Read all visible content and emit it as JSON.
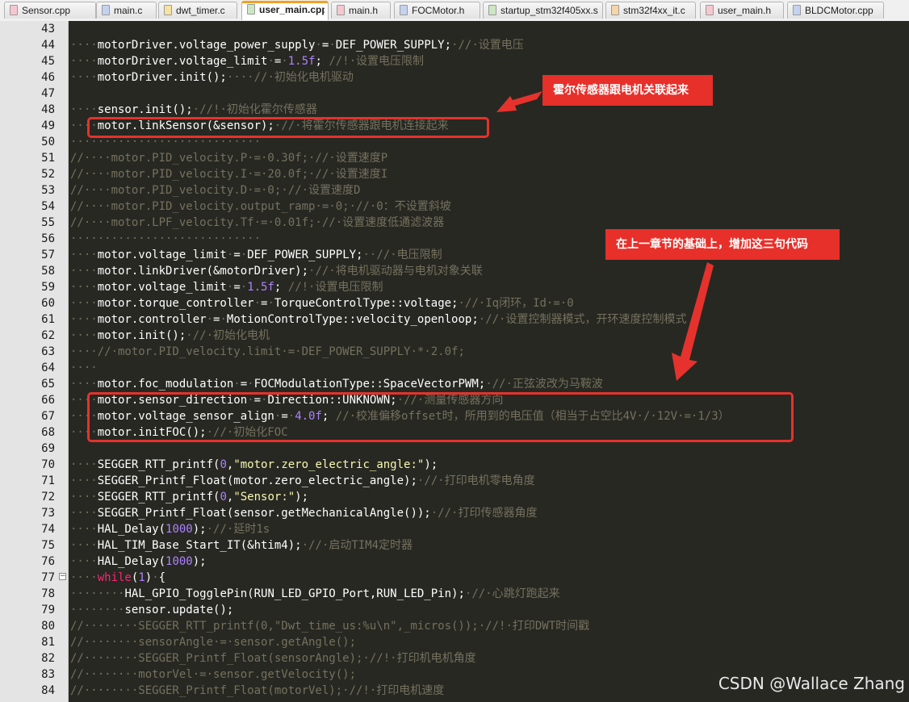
{
  "tabs": [
    {
      "label": "Sensor.cpp",
      "color": "#f7c7cf"
    },
    {
      "label": "main.c",
      "color": "#c5d3f0"
    },
    {
      "label": "dwt_timer.c",
      "color": "#f6e3a0"
    },
    {
      "label": "user_main.cpp",
      "color": "#cde7c2",
      "active": true
    },
    {
      "label": "main.h",
      "color": "#f7c7cf"
    },
    {
      "label": "FOCMotor.h",
      "color": "#c5d3f0"
    },
    {
      "label": "startup_stm32f405xx.s",
      "color": "#cde7c2"
    },
    {
      "label": "stm32f4xx_it.c",
      "color": "#f6d6a8"
    },
    {
      "label": "user_main.h",
      "color": "#f7c7cf"
    },
    {
      "label": "BLDCMotor.cpp",
      "color": "#c5d3f0"
    }
  ],
  "lines": [
    {
      "n": "43",
      "s": []
    },
    {
      "n": "44",
      "s": [
        [
          "ws",
          "····"
        ],
        [
          "",
          "motorDriver.voltage_power_supply"
        ],
        [
          "ws",
          "·"
        ],
        [
          "",
          "="
        ],
        [
          "ws",
          "·"
        ],
        [
          "",
          "DEF_POWER_SUPPLY;"
        ],
        [
          "ws",
          "·"
        ],
        [
          "cm",
          "//·设置电压"
        ]
      ]
    },
    {
      "n": "45",
      "s": [
        [
          "ws",
          "····"
        ],
        [
          "",
          "motorDriver.voltage_limit"
        ],
        [
          "ws",
          "·"
        ],
        [
          "",
          "="
        ],
        [
          "ws",
          "·"
        ],
        [
          "num",
          "1.5f"
        ],
        [
          "",
          "; "
        ],
        [
          "cm",
          "//!·设置电压限制"
        ]
      ]
    },
    {
      "n": "46",
      "s": [
        [
          "ws",
          "····"
        ],
        [
          "",
          "motorDriver.init();"
        ],
        [
          "ws",
          "····"
        ],
        [
          "cm",
          "//·初始化电机驱动"
        ]
      ]
    },
    {
      "n": "47",
      "s": []
    },
    {
      "n": "48",
      "s": [
        [
          "ws",
          "····"
        ],
        [
          "",
          "sensor.init();"
        ],
        [
          "ws",
          "·"
        ],
        [
          "cm",
          "//!·初始化霍尔传感器"
        ]
      ]
    },
    {
      "n": "49",
      "s": [
        [
          "ws",
          "····"
        ],
        [
          "",
          "motor.linkSensor(&sensor);"
        ],
        [
          "ws",
          "·"
        ],
        [
          "cm",
          "//·将霍尔传感器跟电机连接起来"
        ]
      ]
    },
    {
      "n": "50",
      "s": [
        [
          "ws",
          "····························"
        ]
      ]
    },
    {
      "n": "51",
      "s": [
        [
          "cm",
          "//····motor.PID_velocity.P·=·0.30f;·//·设置速度P"
        ]
      ]
    },
    {
      "n": "52",
      "s": [
        [
          "cm",
          "//····motor.PID_velocity.I·=·20.0f;·//·设置速度I"
        ]
      ]
    },
    {
      "n": "53",
      "s": [
        [
          "cm",
          "//····motor.PID_velocity.D·=·0;·//·设置速度D"
        ]
      ]
    },
    {
      "n": "54",
      "s": [
        [
          "cm",
          "//····motor.PID_velocity.output_ramp·=·0;·//·0：不设置斜坡"
        ]
      ]
    },
    {
      "n": "55",
      "s": [
        [
          "cm",
          "//····motor.LPF_velocity.Tf·=·0.01f;·//·设置速度低通滤波器"
        ]
      ]
    },
    {
      "n": "56",
      "s": [
        [
          "ws",
          "····························"
        ]
      ]
    },
    {
      "n": "57",
      "s": [
        [
          "ws",
          "····"
        ],
        [
          "",
          "motor.voltage_limit"
        ],
        [
          "ws",
          "·"
        ],
        [
          "",
          "="
        ],
        [
          "ws",
          "·"
        ],
        [
          "",
          "DEF_POWER_SUPPLY;"
        ],
        [
          "ws",
          "··"
        ],
        [
          "cm",
          "//·电压限制"
        ]
      ]
    },
    {
      "n": "58",
      "s": [
        [
          "ws",
          "····"
        ],
        [
          "",
          "motor.linkDriver(&motorDriver);"
        ],
        [
          "ws",
          "·"
        ],
        [
          "cm",
          "//·将电机驱动器与电机对象关联"
        ]
      ]
    },
    {
      "n": "59",
      "s": [
        [
          "ws",
          "····"
        ],
        [
          "",
          "motor.voltage_limit"
        ],
        [
          "ws",
          "·"
        ],
        [
          "",
          "="
        ],
        [
          "ws",
          "·"
        ],
        [
          "num",
          "1.5f"
        ],
        [
          "",
          "; "
        ],
        [
          "cm",
          "//!·设置电压限制"
        ]
      ]
    },
    {
      "n": "60",
      "s": [
        [
          "ws",
          "····"
        ],
        [
          "",
          "motor.torque_controller"
        ],
        [
          "ws",
          "·"
        ],
        [
          "",
          "="
        ],
        [
          "ws",
          "·"
        ],
        [
          "",
          "TorqueControlType::voltage;"
        ],
        [
          "ws",
          "·"
        ],
        [
          "cm",
          "//·Iq闭环，Id·=·0"
        ]
      ]
    },
    {
      "n": "61",
      "s": [
        [
          "ws",
          "····"
        ],
        [
          "",
          "motor.controller"
        ],
        [
          "ws",
          "·"
        ],
        [
          "",
          "="
        ],
        [
          "ws",
          "·"
        ],
        [
          "",
          "MotionControlType::velocity_openloop;"
        ],
        [
          "ws",
          "·"
        ],
        [
          "cm",
          "//·设置控制器模式，开环速度控制模式"
        ]
      ]
    },
    {
      "n": "62",
      "s": [
        [
          "ws",
          "····"
        ],
        [
          "",
          "motor.init();"
        ],
        [
          "ws",
          "·"
        ],
        [
          "cm",
          "//·初始化电机"
        ]
      ]
    },
    {
      "n": "63",
      "s": [
        [
          "ws",
          "····"
        ],
        [
          "cm",
          "//·motor.PID_velocity.limit·=·DEF_POWER_SUPPLY·*·2.0f;"
        ]
      ]
    },
    {
      "n": "64",
      "s": [
        [
          "ws",
          "····"
        ]
      ]
    },
    {
      "n": "65",
      "s": [
        [
          "ws",
          "····"
        ],
        [
          "",
          "motor.foc_modulation"
        ],
        [
          "ws",
          "·"
        ],
        [
          "",
          "="
        ],
        [
          "ws",
          "·"
        ],
        [
          "",
          "FOCModulationType::SpaceVectorPWM;"
        ],
        [
          "ws",
          "·"
        ],
        [
          "cm",
          "//·正弦波改为马鞍波"
        ]
      ]
    },
    {
      "n": "66",
      "s": [
        [
          "ws",
          "····"
        ],
        [
          "",
          "motor.sensor_direction"
        ],
        [
          "ws",
          "·"
        ],
        [
          "",
          "="
        ],
        [
          "ws",
          "·"
        ],
        [
          "",
          "Direction::UNKNOWN;"
        ],
        [
          "ws",
          "·"
        ],
        [
          "cm",
          "//·测量传感器方向"
        ]
      ]
    },
    {
      "n": "67",
      "s": [
        [
          "ws",
          "····"
        ],
        [
          "",
          "motor.voltage_sensor_align"
        ],
        [
          "ws",
          "·"
        ],
        [
          "",
          "="
        ],
        [
          "ws",
          "·"
        ],
        [
          "num",
          "4.0f"
        ],
        [
          "",
          "; "
        ],
        [
          "cm",
          "//·校准偏移offset时，所用到的电压值（相当于占空比4V·/·12V·=·1/3）"
        ]
      ]
    },
    {
      "n": "68",
      "s": [
        [
          "ws",
          "····"
        ],
        [
          "",
          "motor.initFOC();"
        ],
        [
          "ws",
          "·"
        ],
        [
          "cm",
          "//·初始化FOC"
        ]
      ]
    },
    {
      "n": "69",
      "s": []
    },
    {
      "n": "70",
      "s": [
        [
          "ws",
          "····"
        ],
        [
          "",
          "SEGGER_RTT_printf("
        ],
        [
          "num",
          "0"
        ],
        [
          "",
          ","
        ],
        [
          "str",
          "\"motor.zero_electric_angle:\""
        ],
        [
          "",
          ");"
        ]
      ]
    },
    {
      "n": "71",
      "s": [
        [
          "ws",
          "····"
        ],
        [
          "",
          "SEGGER_Printf_Float(motor.zero_electric_angle);"
        ],
        [
          "ws",
          "·"
        ],
        [
          "cm",
          "//·打印电机零电角度"
        ]
      ]
    },
    {
      "n": "72",
      "s": [
        [
          "ws",
          "····"
        ],
        [
          "",
          "SEGGER_RTT_printf("
        ],
        [
          "num",
          "0"
        ],
        [
          "",
          ","
        ],
        [
          "str",
          "\"Sensor:\""
        ],
        [
          "",
          ");"
        ]
      ]
    },
    {
      "n": "73",
      "s": [
        [
          "ws",
          "····"
        ],
        [
          "",
          "SEGGER_Printf_Float(sensor.getMechanicalAngle());"
        ],
        [
          "ws",
          "·"
        ],
        [
          "cm",
          "//·打印传感器角度"
        ]
      ]
    },
    {
      "n": "74",
      "s": [
        [
          "ws",
          "····"
        ],
        [
          "",
          "HAL_Delay("
        ],
        [
          "num",
          "1000"
        ],
        [
          "",
          ");"
        ],
        [
          "ws",
          "·"
        ],
        [
          "cm",
          "//·延时1s"
        ]
      ]
    },
    {
      "n": "75",
      "s": [
        [
          "ws",
          "····"
        ],
        [
          "",
          "HAL_TIM_Base_Start_IT(&htim4);"
        ],
        [
          "ws",
          "·"
        ],
        [
          "cm",
          "//·启动TIM4定时器"
        ]
      ]
    },
    {
      "n": "76",
      "s": [
        [
          "ws",
          "····"
        ],
        [
          "",
          "HAL_Delay("
        ],
        [
          "num",
          "1000"
        ],
        [
          "",
          ");"
        ]
      ]
    },
    {
      "n": "77",
      "fold": "−",
      "s": [
        [
          "ws",
          "····"
        ],
        [
          "kw",
          "while"
        ],
        [
          "",
          "("
        ],
        [
          "num",
          "1"
        ],
        [
          "",
          ")"
        ],
        [
          "ws",
          "·"
        ],
        [
          "",
          "{"
        ]
      ]
    },
    {
      "n": "78",
      "s": [
        [
          "ws",
          "········"
        ],
        [
          "",
          "HAL_GPIO_TogglePin(RUN_LED_GPIO_Port,RUN_LED_Pin);"
        ],
        [
          "ws",
          "·"
        ],
        [
          "cm",
          "//·心跳灯跑起来"
        ]
      ]
    },
    {
      "n": "79",
      "s": [
        [
          "ws",
          "········"
        ],
        [
          "",
          "sensor.update();"
        ]
      ]
    },
    {
      "n": "80",
      "s": [
        [
          "cm",
          "//········SEGGER_RTT_printf(0,\"Dwt_time_us:%u\\n\",_micros());·//!·打印DWT时间戳"
        ]
      ]
    },
    {
      "n": "81",
      "s": [
        [
          "cm",
          "//········sensorAngle·=·sensor.getAngle();"
        ]
      ]
    },
    {
      "n": "82",
      "s": [
        [
          "cm",
          "//········SEGGER_Printf_Float(sensorAngle);·//!·打印机电机角度"
        ]
      ]
    },
    {
      "n": "83",
      "s": [
        [
          "cm",
          "//········motorVel·=·sensor.getVelocity();"
        ]
      ]
    },
    {
      "n": "84",
      "s": [
        [
          "cm",
          "//········SEGGER_Printf_Float(motorVel);·//!·打印电机速度"
        ]
      ]
    }
  ],
  "annotations": {
    "callout1": "霍尔传感器跟电机关联起来",
    "callout2": "在上一章节的基础上，增加这三句代码"
  },
  "watermark": "CSDN @Wallace Zhang",
  "colors": {
    "highlight": "#e5322d",
    "accent_tab": "#f4a020"
  }
}
